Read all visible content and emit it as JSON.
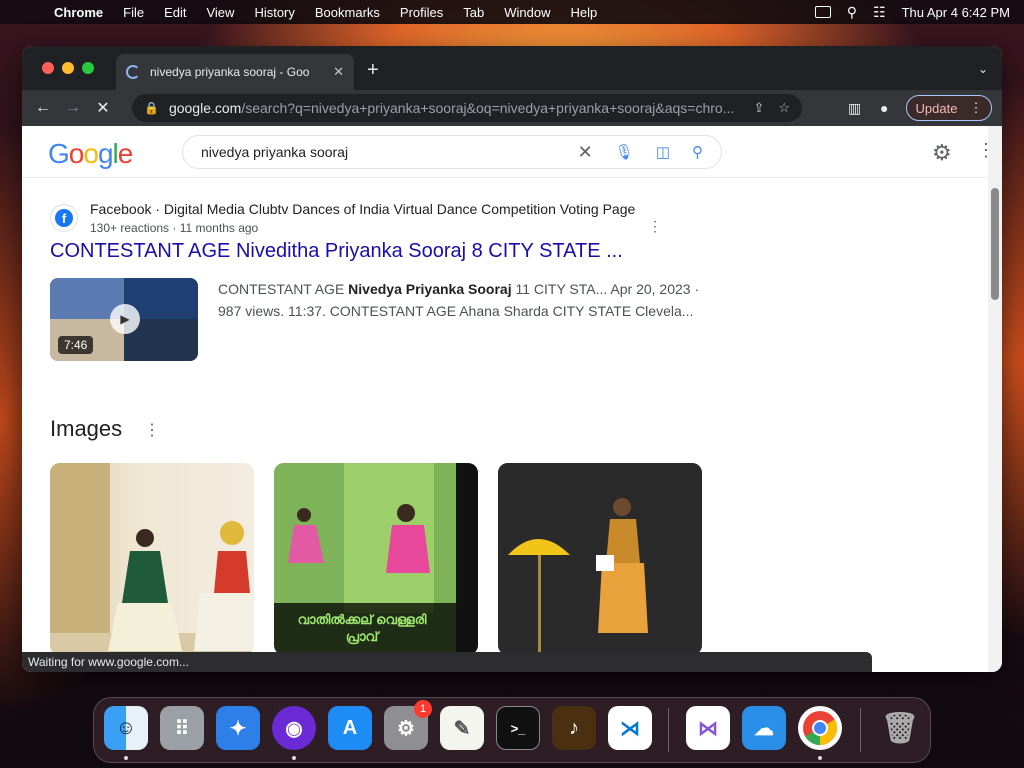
{
  "menubar": {
    "app": "Chrome",
    "items": [
      "File",
      "Edit",
      "View",
      "History",
      "Bookmarks",
      "Profiles",
      "Tab",
      "Window",
      "Help"
    ],
    "datetime": "Thu Apr 4  6:42 PM"
  },
  "browser": {
    "tab_title": "nivedya priyanka sooraj - Goo",
    "url_host": "google.com",
    "url_path": "/search?q=nivedya+priyanka+sooraj&oq=nivedya+priyanka+sooraj&aqs=chro...",
    "update_label": "Update",
    "status": "Waiting for www.google.com..."
  },
  "google": {
    "logo": "Google",
    "query": "nivedya priyanka sooraj"
  },
  "result": {
    "source": "Facebook · Digital Media Clubtv Dances of India Virtual Dance Competition Voting Page",
    "meta": "130+ reactions · 11 months ago",
    "title": "CONTESTANT AGE Niveditha Priyanka Sooraj 8 CITY STATE ...",
    "duration": "7:46",
    "snippet_pre": "CONTESTANT AGE ",
    "snippet_bold": "Nivedya Priyanka Sooraj",
    "snippet_post": " 11 CITY STA... Apr 20, 2023 · 987 views. 11:37. CONTESTANT AGE Ahana Sharda CITY STATE Clevela..."
  },
  "images": {
    "heading": "Images",
    "caption2": "വാതിൽക്കല് വെള്ളരി പ്രാവ്"
  },
  "dock": {
    "badge": "1"
  },
  "colors": {
    "google_blue": "#4285f4",
    "google_red": "#ea4335",
    "google_yellow": "#fbbc05",
    "google_green": "#34a853",
    "link": "#1a0dab"
  }
}
